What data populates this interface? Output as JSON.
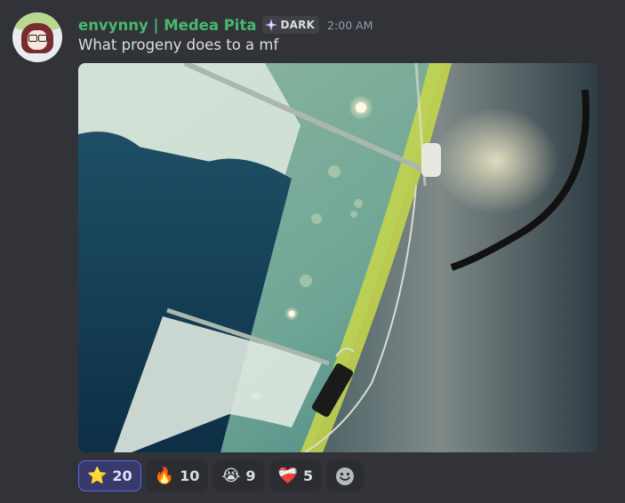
{
  "message": {
    "username": "envynny | Medea Pita",
    "role_badge": "DARK",
    "timestamp": "2:00 AM",
    "text": "What progeny does to a mf",
    "username_color": "#48b86b"
  },
  "attachment": {
    "type": "photo"
  },
  "reactions": [
    {
      "emoji": "⭐",
      "icon": "star-emoji",
      "count": "20",
      "active": true
    },
    {
      "emoji": "🔥",
      "icon": "fire-emoji",
      "count": "10",
      "active": false
    },
    {
      "emoji": "😭",
      "icon": "crying-face-emoji",
      "count": "9",
      "active": false
    },
    {
      "emoji": "❤️‍🩹",
      "icon": "mending-heart-emoji",
      "count": "5",
      "active": false
    }
  ],
  "add_reaction": {
    "icon": "add-reaction-smiley-icon"
  },
  "colors": {
    "background": "#313338",
    "active_reaction_border": "#5865f2"
  }
}
